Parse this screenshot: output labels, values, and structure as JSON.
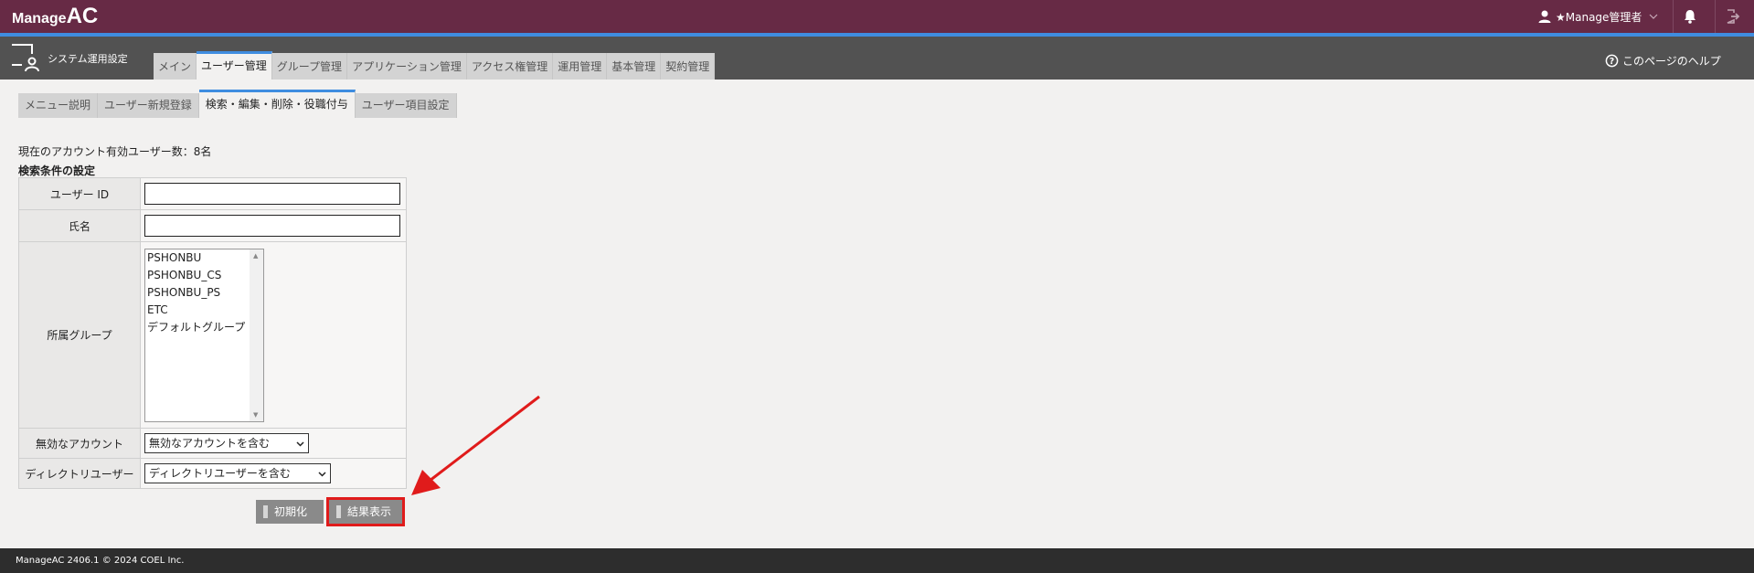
{
  "header": {
    "logo_part1": "Manage",
    "logo_part2": "AC",
    "user_label": "★Manage管理者",
    "icons": [
      "user-icon",
      "chevron-down-icon",
      "bell-icon",
      "logout-icon"
    ]
  },
  "nav": {
    "section_title": "システム運用設定",
    "tabs": [
      "メイン",
      "ユーザー管理",
      "グループ管理",
      "アプリケーション管理",
      "アクセス権管理",
      "運用管理",
      "基本管理",
      "契約管理"
    ],
    "active_tab": "ユーザー管理",
    "help_label": "このページのヘルプ"
  },
  "subtabs": {
    "items": [
      "メニュー説明",
      "ユーザー新規登録",
      "検索・編集・削除・役職付与",
      "ユーザー項目設定"
    ],
    "active": "検索・編集・削除・役職付与"
  },
  "info": {
    "active_count": "現在のアカウント有効ユーザー数：8名",
    "section_title": "検索条件の設定"
  },
  "form": {
    "userid_label": "ユーザー ID",
    "userid_value": "",
    "name_label": "氏名",
    "name_value": "",
    "group_label": "所属グループ",
    "groups": [
      "PSHONBU",
      "PSHONBU_CS",
      "PSHONBU_PS",
      "ETC",
      "デフォルトグループ"
    ],
    "invalid_label": "無効なアカウント",
    "invalid_value": "無効なアカウントを含む",
    "directory_label": "ディレクトリユーザー",
    "directory_value": "ディレクトリユーザーを含む"
  },
  "buttons": {
    "reset": "初期化",
    "show_results": "結果表示"
  },
  "annotation": {
    "color": "#e01b1b"
  },
  "footer": {
    "text": "ManageAC 2406.1 © 2024 COEL Inc."
  },
  "colors": {
    "header_bg": "#672a45",
    "accent": "#3f8de0",
    "nav_bg": "#525252"
  }
}
